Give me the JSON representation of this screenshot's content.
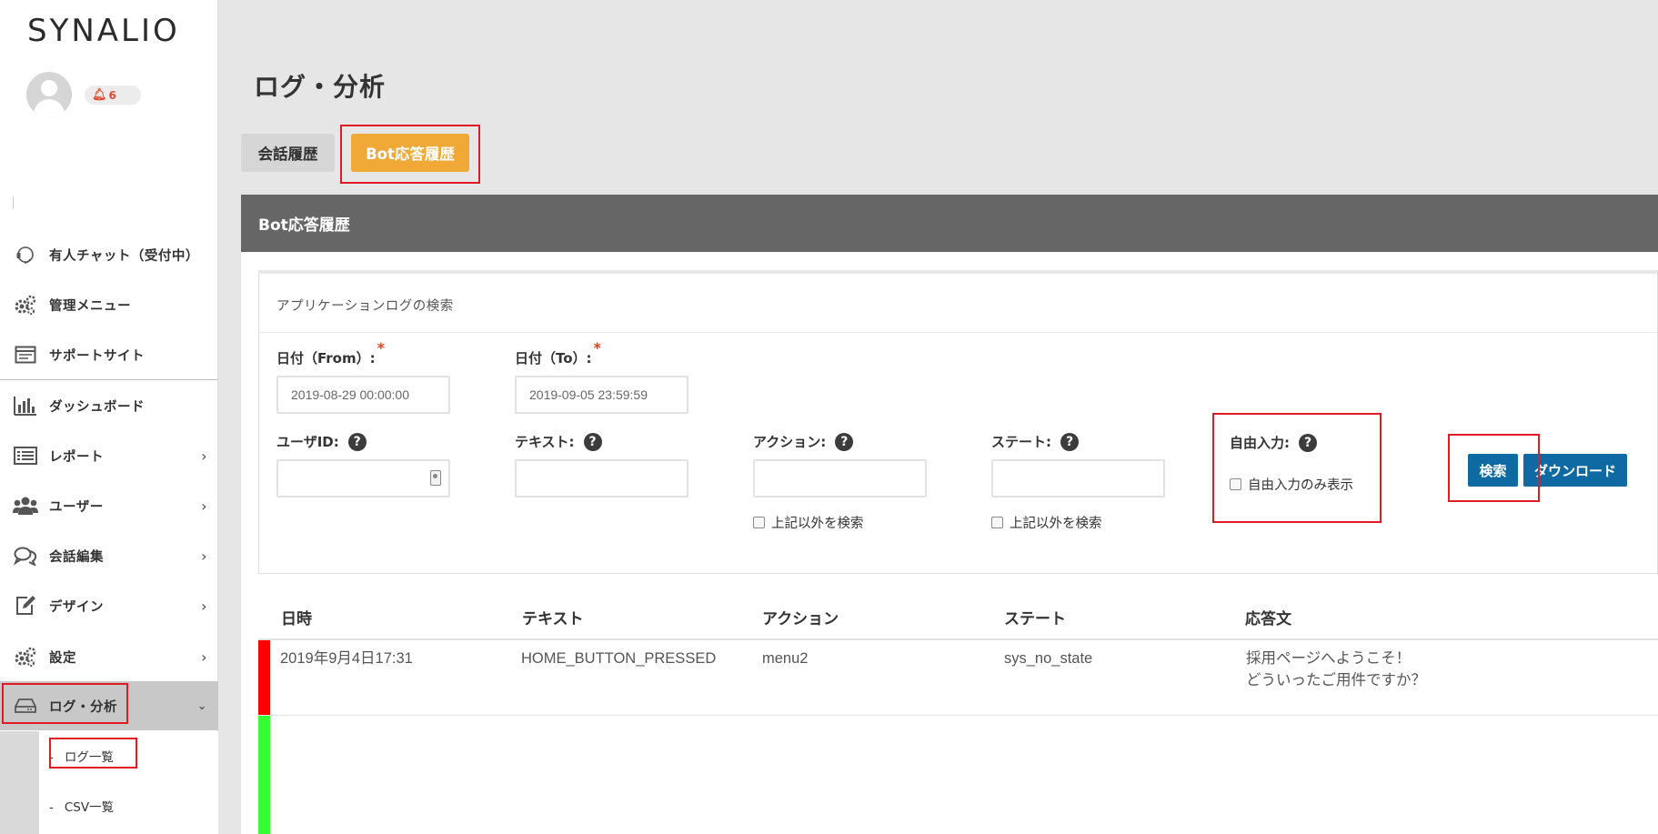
{
  "brand": {
    "name": "SYNALIO",
    "dot_colors": [
      "#f0a836",
      "#2da8d8",
      "#e84e3b"
    ]
  },
  "user": {
    "notification_count": "6"
  },
  "sidebar": {
    "items": [
      {
        "label": "有人チャット（受付中）",
        "icon": "headset-icon"
      },
      {
        "label": "管理メニュー",
        "icon": "gears-icon"
      },
      {
        "label": "サポートサイト",
        "icon": "browser-window-icon"
      },
      {
        "label": "ダッシュボード",
        "icon": "bar-chart-icon"
      },
      {
        "label": "レポート",
        "icon": "list-icon"
      },
      {
        "label": "ユーザー",
        "icon": "users-icon"
      },
      {
        "label": "会話編集",
        "icon": "chat-bubbles-icon"
      },
      {
        "label": "デザイン",
        "icon": "edit-icon"
      },
      {
        "label": "設定",
        "icon": "gears-icon"
      },
      {
        "label": "ログ・分析",
        "icon": "hard-drive-icon"
      }
    ],
    "sub_items": [
      {
        "label": "ログ一覧"
      },
      {
        "label": "CSV一覧"
      }
    ]
  },
  "main": {
    "title": "ログ・分析",
    "tabs": [
      {
        "label": "会話履歴"
      },
      {
        "label": "Bot応答履歴"
      }
    ],
    "panel_title": "Bot応答履歴",
    "search": {
      "title": "アプリケーションログの検索",
      "date_from": {
        "label": "日付（From）:",
        "value": "2019-08-29 00:00:00"
      },
      "date_to": {
        "label": "日付（To）:",
        "value": "2019-09-05 23:59:59"
      },
      "user_id": {
        "label": "ユーザID:",
        "value": ""
      },
      "text": {
        "label": "テキスト:",
        "value": ""
      },
      "action": {
        "label": "アクション:",
        "value": "",
        "exclude_label": "上記以外を検索"
      },
      "state": {
        "label": "ステート:",
        "value": "",
        "exclude_label": "上記以外を検索"
      },
      "free_input": {
        "label": "自由入力:",
        "only_label": "自由入力のみ表示"
      },
      "search_button": "検索",
      "download_button": "ダウンロード"
    },
    "table": {
      "headers": [
        "日時",
        "テキスト",
        "アクション",
        "ステート",
        "応答文"
      ],
      "rows": [
        {
          "datetime": "2019年9月4日17:31",
          "text": "HOME_BUTTON_PRESSED",
          "action": "menu2",
          "state": "sys_no_state",
          "response_line1": "採用ページへようこそ！",
          "response_line2": "どういったご用件ですか？",
          "status_color": "#ff0000"
        },
        {
          "status_color": "#33ff33"
        }
      ]
    }
  },
  "colors": {
    "accent_orange": "#f0a836",
    "primary_blue": "#0f6aa3",
    "annotation_red": "#e01b24"
  }
}
